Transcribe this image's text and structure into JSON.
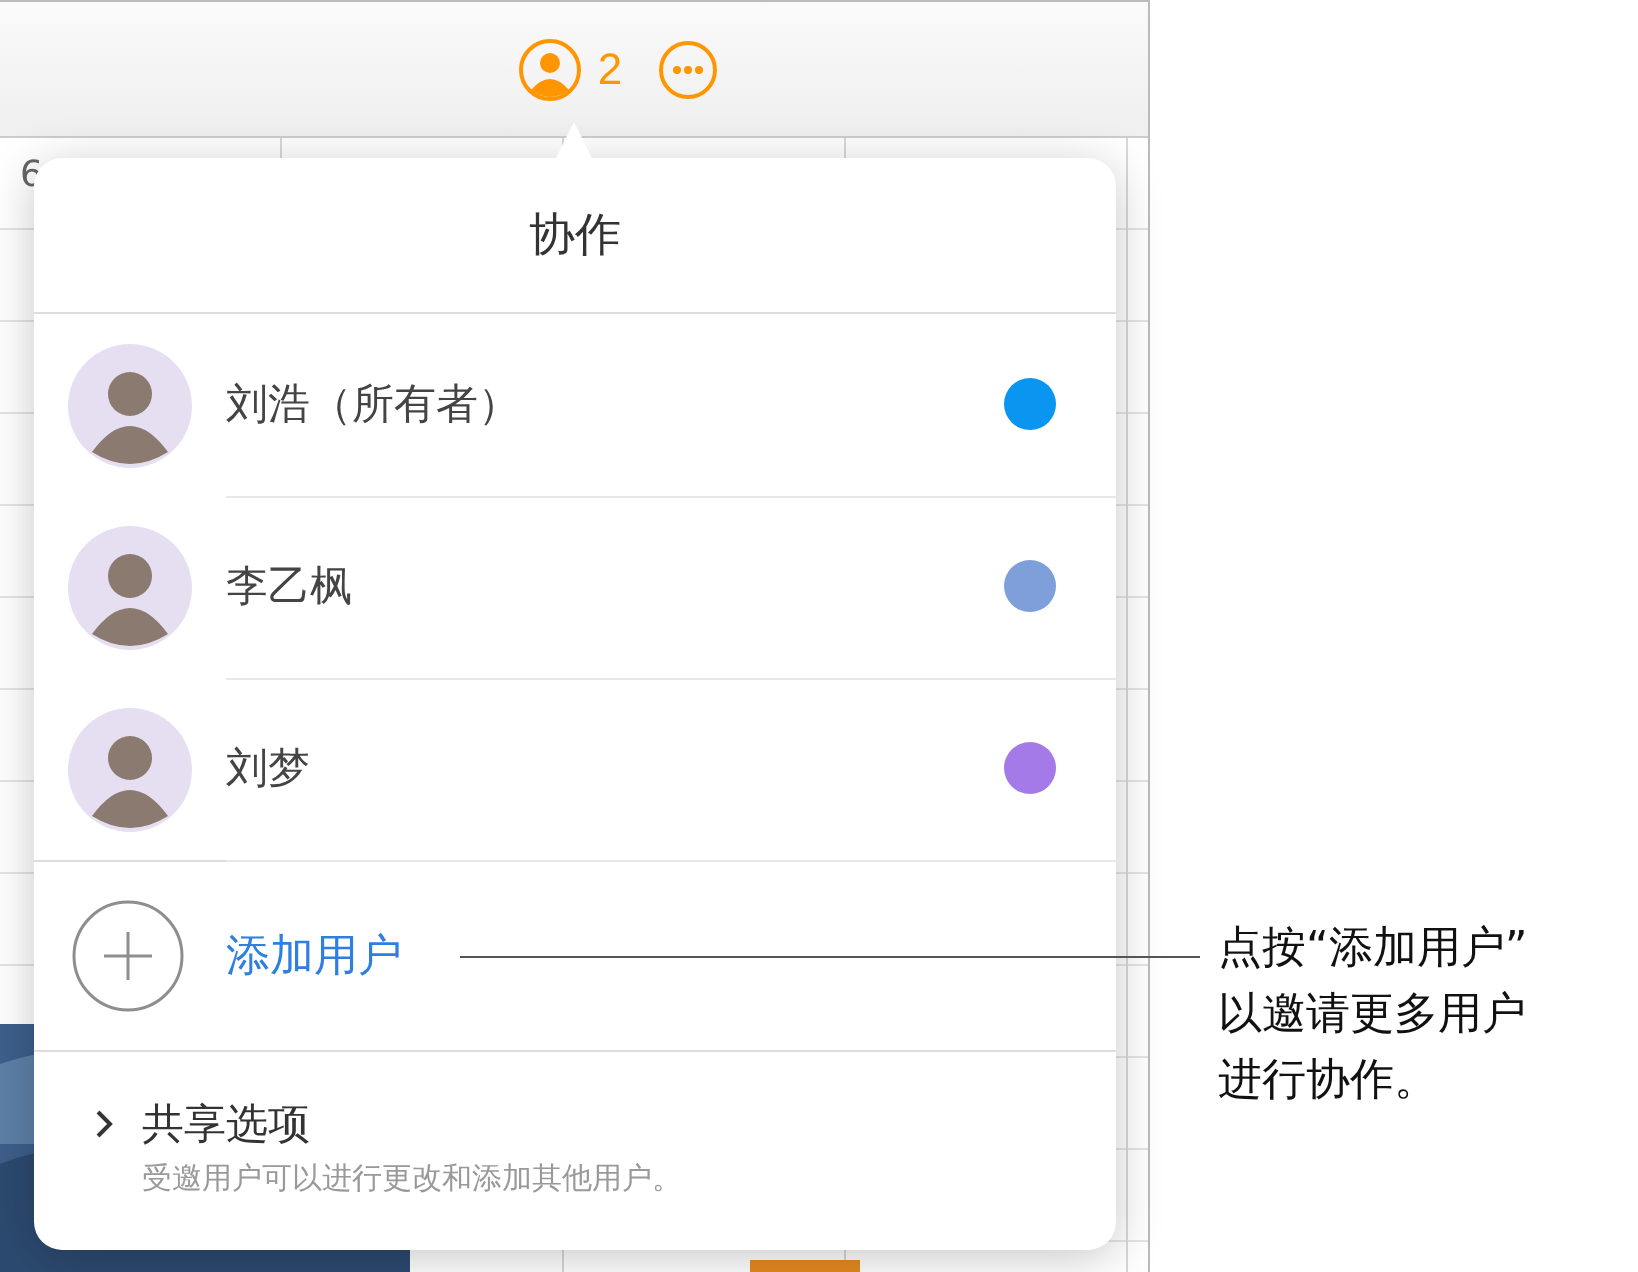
{
  "toolbar": {
    "collaborator_count": "2"
  },
  "background": {
    "cell_text": "6"
  },
  "popover": {
    "title": "协作",
    "members": [
      {
        "name": "刘浩（所有者）",
        "color": "#0a95f0"
      },
      {
        "name": "李乙枫",
        "color": "#7f9fda"
      },
      {
        "name": "刘梦",
        "color": "#a37ae8"
      }
    ],
    "add_label": "添加用户",
    "share": {
      "title": "共享选项",
      "subtitle": "受邀用户可以进行更改和添加其他用户。"
    }
  },
  "callout": [
    "点按“添加用户”",
    "以邀请更多用户",
    "进行协作。"
  ]
}
